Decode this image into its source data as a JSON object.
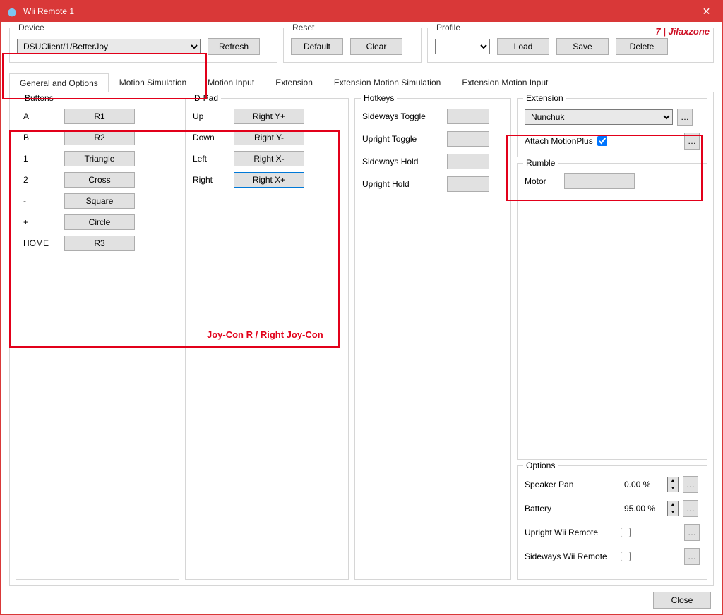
{
  "titlebar": {
    "title": "Wii Remote 1"
  },
  "watermark": "7 | Jilaxzone",
  "device": {
    "label": "Device",
    "selected": "DSUClient/1/BetterJoy",
    "refresh": "Refresh"
  },
  "reset": {
    "label": "Reset",
    "default": "Default",
    "clear": "Clear"
  },
  "profile": {
    "label": "Profile",
    "load": "Load",
    "save": "Save",
    "delete": "Delete"
  },
  "tabs": [
    "General and Options",
    "Motion Simulation",
    "Motion Input",
    "Extension",
    "Extension Motion Simulation",
    "Extension Motion Input"
  ],
  "buttons": {
    "title": "Buttons",
    "rows": [
      {
        "lbl": "A",
        "val": "R1"
      },
      {
        "lbl": "B",
        "val": "R2"
      },
      {
        "lbl": "1",
        "val": "Triangle"
      },
      {
        "lbl": "2",
        "val": "Cross"
      },
      {
        "lbl": "-",
        "val": "Square"
      },
      {
        "lbl": "+",
        "val": "Circle"
      },
      {
        "lbl": "HOME",
        "val": "R3"
      }
    ]
  },
  "dpad": {
    "title": "D-Pad",
    "rows": [
      {
        "lbl": "Up",
        "val": "Right Y+"
      },
      {
        "lbl": "Down",
        "val": "Right Y-"
      },
      {
        "lbl": "Left",
        "val": "Right X-"
      },
      {
        "lbl": "Right",
        "val": "Right X+"
      }
    ]
  },
  "hotkeys": {
    "title": "Hotkeys",
    "rows": [
      "Sideways Toggle",
      "Upright Toggle",
      "Sideways Hold",
      "Upright Hold"
    ]
  },
  "extension": {
    "title": "Extension",
    "selected": "Nunchuk",
    "attach_label": "Attach MotionPlus",
    "attach_checked": true
  },
  "rumble": {
    "title": "Rumble",
    "motor": "Motor"
  },
  "options": {
    "title": "Options",
    "speaker_label": "Speaker Pan",
    "speaker_val": "0.00 %",
    "battery_label": "Battery",
    "battery_val": "95.00 %",
    "upright_label": "Upright Wii Remote",
    "sideways_label": "Sideways Wii Remote"
  },
  "footer": {
    "close": "Close"
  },
  "annot": {
    "joycon": "Joy-Con R / Right Joy-Con"
  }
}
